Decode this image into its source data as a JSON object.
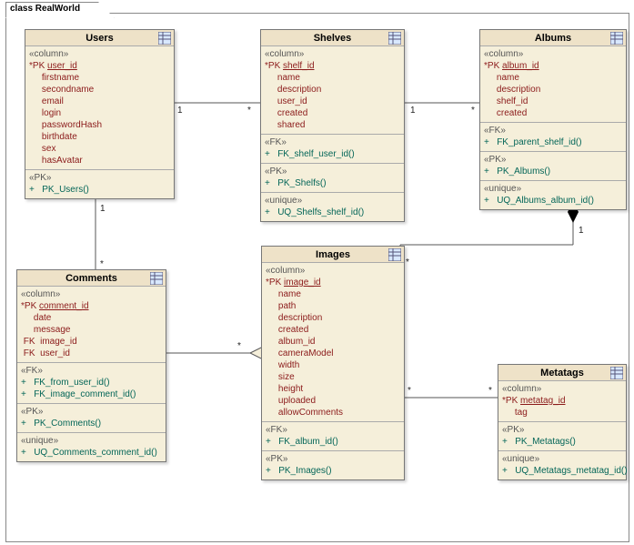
{
  "frame": {
    "title": "class RealWorld"
  },
  "sym": {
    "star": "*",
    "pk": "PK",
    "plus": "+"
  },
  "stereo": {
    "col": "«column»",
    "pk": "«PK»",
    "fk": "«FK»",
    "uq": "«unique»"
  },
  "users": {
    "name": "Users",
    "cols": [
      "user_id",
      "firstname",
      "secondname",
      "email",
      "login",
      "passwordHash",
      "birthdate",
      "sex",
      "hasAvatar"
    ],
    "pk": "PK_Users()"
  },
  "shelves": {
    "name": "Shelves",
    "cols": [
      "shelf_id",
      "name",
      "description",
      "user_id",
      "created",
      "shared"
    ],
    "fk": "FK_shelf_user_id()",
    "pk": "PK_Shelfs()",
    "uq": "UQ_Shelfs_shelf_id()"
  },
  "albums": {
    "name": "Albums",
    "cols": [
      "album_id",
      "name",
      "description",
      "shelf_id",
      "created"
    ],
    "fk": "FK_parent_shelf_id()",
    "pk": "PK_Albums()",
    "uq": "UQ_Albums_album_id()"
  },
  "comments": {
    "name": "Comments",
    "cols": [
      "comment_id",
      "date",
      "message",
      "image_id",
      "user_id"
    ],
    "fk": [
      "FK_from_user_id()",
      "FK_image_comment_id()"
    ],
    "pk": "PK_Comments()",
    "uq": "UQ_Comments_comment_id()"
  },
  "images": {
    "name": "Images",
    "cols": [
      "image_id",
      "name",
      "path",
      "description",
      "created",
      "album_id",
      "cameraModel",
      "width",
      "size",
      "height",
      "uploaded",
      "allowComments"
    ],
    "fk": "FK_album_id()",
    "pk": "PK_Images()"
  },
  "metatags": {
    "name": "Metatags",
    "cols": [
      "metatag_id",
      "tag"
    ],
    "pk": "PK_Metatags()",
    "uq": "UQ_Metatags_metatag_id()"
  },
  "rel": {
    "r1": {
      "a": "1",
      "b": "*"
    },
    "r2": {
      "a": "1",
      "b": "*"
    },
    "r3": {
      "a": "1",
      "b": "*"
    },
    "r4": {
      "a": "*",
      "b": "1"
    },
    "r5": {
      "a": "1",
      "b": "*"
    },
    "r6": {
      "a": "*",
      "b": "*"
    }
  }
}
